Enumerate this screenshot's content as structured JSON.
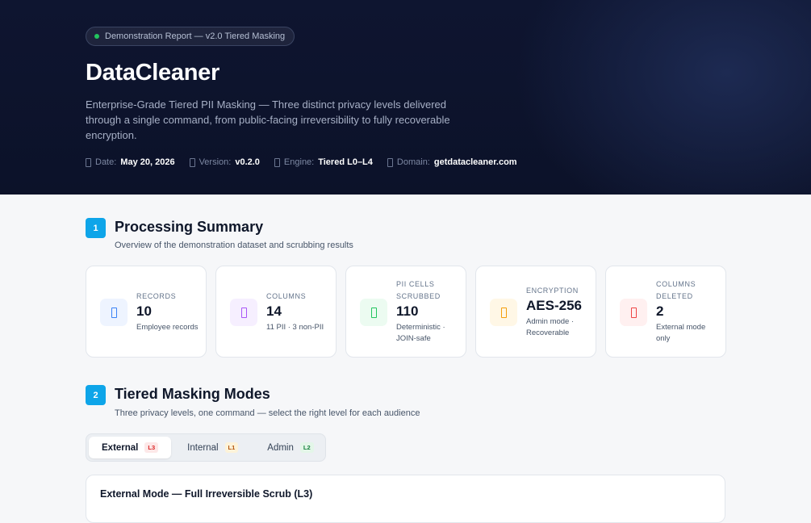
{
  "hero": {
    "badge": "Demonstration Report — v2.0 Tiered Masking",
    "title": "DataCleaner",
    "lead": "Enterprise-Grade Tiered PII Masking — Three distinct privacy levels delivered through a single command, from public-facing irreversibility to fully recoverable encryption.",
    "meta": [
      {
        "icon": "calendar-icon",
        "label": "Date:",
        "value": "May 20, 2026"
      },
      {
        "icon": "tag-icon",
        "label": "Version:",
        "value": "v0.2.0"
      },
      {
        "icon": "cpu-icon",
        "label": "Engine:",
        "value": "Tiered L0–L4"
      },
      {
        "icon": "globe-icon",
        "label": "Domain:",
        "value": "getdatacleaner.com"
      }
    ]
  },
  "section1": {
    "number": "1",
    "title": "Processing Summary",
    "subtitle": "Overview of the demonstration dataset and scrubbing results"
  },
  "cards": [
    {
      "icon": "users-icon",
      "label": "Records",
      "value": "10",
      "sub": "Employee records",
      "color": "#3b82f6",
      "bg": "#eef4ff"
    },
    {
      "icon": "columns-icon",
      "label": "Columns",
      "value": "14",
      "sub": "11 PII · 3 non-PII",
      "color": "#a855f7",
      "bg": "#f6efff"
    },
    {
      "icon": "shield-icon",
      "label": "PII Cells Scrubbed",
      "value": "110",
      "sub": "Deterministic · JOIN-safe",
      "color": "#22c55e",
      "bg": "#ecfbf1"
    },
    {
      "icon": "lock-icon",
      "label": "Encryption",
      "value": "AES-256",
      "sub": "Admin mode · Recoverable",
      "color": "#f59e0b",
      "bg": "#fff7e6"
    },
    {
      "icon": "trash-icon",
      "label": "Columns Deleted",
      "value": "2",
      "sub": "External mode only",
      "color": "#ef4444",
      "bg": "#fff0f0"
    }
  ],
  "section2": {
    "number": "2",
    "title": "Tiered Masking Modes",
    "subtitle": "Three privacy levels, one command — select the right level for each audience"
  },
  "tabs": [
    {
      "label": "External",
      "level": "L3",
      "color": "#dc2626",
      "bg": "#fde8e8"
    },
    {
      "label": "Internal",
      "level": "L1",
      "color": "#b45309",
      "bg": "#fdf3d9"
    },
    {
      "label": "Admin",
      "level": "L2",
      "color": "#15803d",
      "bg": "#e3f6e8"
    }
  ],
  "mode_card": {
    "title": "External Mode — Full Irreversible Scrub (L3)"
  }
}
